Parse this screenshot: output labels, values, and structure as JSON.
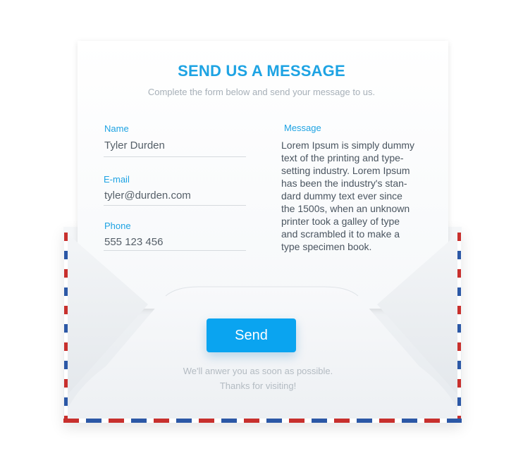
{
  "header": {
    "title": "SEND US A MESSAGE",
    "subtitle": "Complete the form below and send your message to us."
  },
  "form": {
    "name": {
      "label": "Name",
      "value": "Tyler Durden"
    },
    "email": {
      "label": "E-mail",
      "value": "tyler@durden.com"
    },
    "phone": {
      "label": "Phone",
      "value": "555 123 456"
    },
    "message": {
      "label": "Message",
      "value": "Lorem Ipsum is simply dummy text of the printing and type-setting industry. Lorem Ipsum has been the industry's stan-dard dummy text ever since the 1500s, when an unknown printer took a galley of type and scrambled it to make a type specimen book."
    }
  },
  "actions": {
    "send_label": "Send"
  },
  "footer": {
    "line1": "We'll anwer you as soon as possible.",
    "line2": "Thanks for visiting!"
  },
  "colors": {
    "accent": "#1ea3e3",
    "button": "#0aa4f0",
    "stripe_red": "#c8302d",
    "stripe_blue": "#2c58a6"
  }
}
